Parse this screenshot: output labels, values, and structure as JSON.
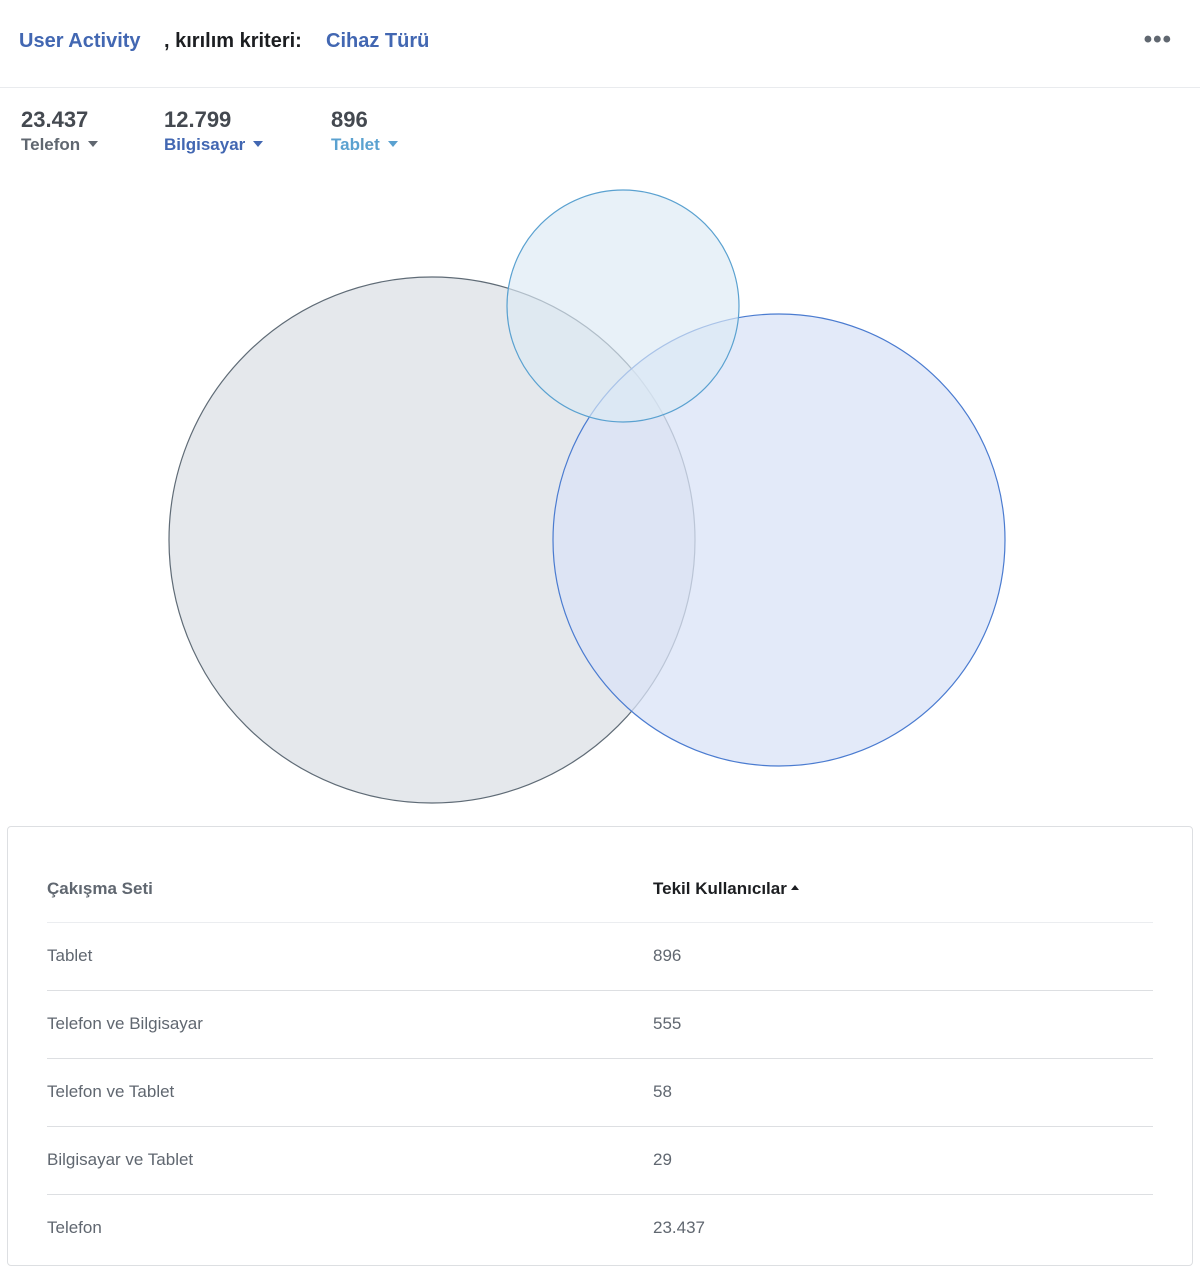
{
  "header": {
    "metric": "User Activity",
    "connector": ", kırılım kriteri:",
    "breakdown": "Cihaz Türü",
    "more_icon": "•••"
  },
  "stats": [
    {
      "value": "23.437",
      "label": "Telefon",
      "color": "#606770"
    },
    {
      "value": "12.799",
      "label": "Bilgisayar",
      "color": "#4267b2"
    },
    {
      "value": "896",
      "label": "Tablet",
      "color": "#5aa1d0"
    }
  ],
  "venn_colors": {
    "telefon": {
      "fill": "#e2e6ea",
      "stroke": "#5f6b76"
    },
    "bilgisayar": {
      "fill": "#d9e3f7",
      "stroke": "#4a7bd0"
    },
    "tablet": {
      "fill": "#dbeaf5",
      "stroke": "#5aa1d0"
    }
  },
  "table": {
    "headers": [
      "Çakışma Seti",
      "Tekil Kullanıcılar"
    ],
    "rows": [
      {
        "set": "Tablet",
        "users": "896"
      },
      {
        "set": "Telefon ve Bilgisayar",
        "users": "555"
      },
      {
        "set": "Telefon ve Tablet",
        "users": "58"
      },
      {
        "set": "Bilgisayar ve Tablet",
        "users": "29"
      },
      {
        "set": "Telefon",
        "users": "23.437"
      }
    ]
  }
}
